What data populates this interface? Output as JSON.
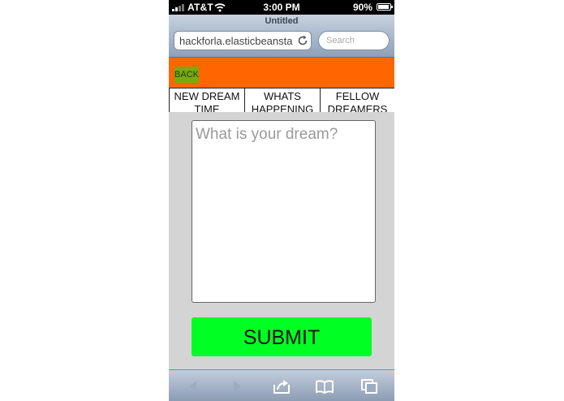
{
  "status_bar": {
    "carrier": "AT&T",
    "time": "3:00 PM",
    "battery": "90%",
    "battery_level": 0.9
  },
  "browser": {
    "page_title": "Untitled",
    "url": "hackforla.elasticbeanstalk",
    "search_placeholder": "Search"
  },
  "app": {
    "back_label": "BACK",
    "tabs": [
      {
        "label": "NEW DREAM TIME"
      },
      {
        "label": "WHATS HAPPENING"
      },
      {
        "label": "FELLOW DREAMERS"
      }
    ],
    "dream_placeholder": "What is your dream?",
    "submit_label": "SUBMIT"
  },
  "colors": {
    "header": "#ff6600",
    "back_button": "#77aa11",
    "submit_button": "#00ff22",
    "content_bg": "#d4d4d4"
  },
  "toolbar_icons": [
    "back-arrow-icon",
    "forward-arrow-icon",
    "share-icon",
    "bookmarks-icon",
    "tabs-icon"
  ]
}
